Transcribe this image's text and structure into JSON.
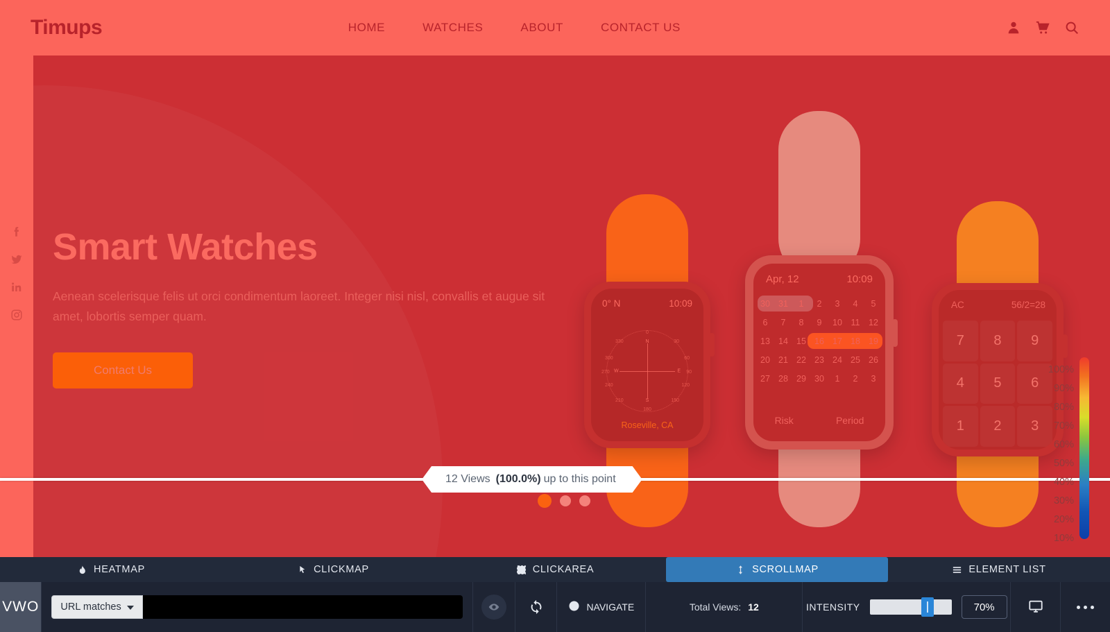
{
  "site": {
    "brand": "Timups",
    "nav": [
      {
        "label": "HOME"
      },
      {
        "label": "WATCHES"
      },
      {
        "label": "ABOUT"
      },
      {
        "label": "CONTACT US"
      }
    ],
    "header_icons": [
      {
        "name": "user-icon"
      },
      {
        "name": "cart-icon"
      },
      {
        "name": "search-icon"
      }
    ],
    "social": [
      {
        "name": "facebook-icon"
      },
      {
        "name": "twitter-icon"
      },
      {
        "name": "linkedin-icon"
      },
      {
        "name": "instagram-icon"
      }
    ],
    "hero": {
      "title": "Smart Watches",
      "subtitle": "Aenean scelerisque felis ut orci condimentum laoreet. Integer nisi nisl, convallis et augue sit amet, lobortis semper quam.",
      "cta": "Contact Us"
    },
    "watches": {
      "compass": {
        "bearing": "0° N",
        "time": "10:09",
        "location": "Roseville, CA",
        "cardinals": [
          "N",
          "S",
          "W",
          "E"
        ],
        "degrees": [
          "0",
          "30",
          "60",
          "90",
          "120",
          "150",
          "180",
          "210",
          "240",
          "270",
          "300",
          "330"
        ]
      },
      "calendar": {
        "date": "Apr, 12",
        "time": "10:09",
        "weeks": [
          [
            "30",
            "31",
            "1",
            "2",
            "3",
            "4",
            "5"
          ],
          [
            "6",
            "7",
            "8",
            "9",
            "10",
            "11",
            "12"
          ],
          [
            "13",
            "14",
            "15",
            "16",
            "17",
            "18",
            "19"
          ],
          [
            "20",
            "21",
            "22",
            "23",
            "24",
            "25",
            "26"
          ],
          [
            "27",
            "28",
            "29",
            "30",
            "1",
            "2",
            "3"
          ]
        ],
        "buttons": [
          "Risk",
          "Period"
        ]
      },
      "calculator": {
        "clear": "AC",
        "expression": "56/2=28",
        "keys": [
          "7",
          "8",
          "9",
          "4",
          "5",
          "6",
          "1",
          "2",
          "3"
        ]
      }
    }
  },
  "scrollmap": {
    "tooltip": {
      "views": "12 Views",
      "percent": "(100.0%)",
      "suffix": "up to this point"
    },
    "legend_labels": [
      "100%",
      "90%",
      "80%",
      "70%",
      "60%",
      "50%",
      "40%",
      "30%",
      "20%",
      "10%"
    ],
    "carousel_dots": 3,
    "active_dot": 0
  },
  "vwo": {
    "logo": "VWO",
    "tabs": [
      {
        "label": "HEATMAP",
        "icon": "flame-icon",
        "active": false
      },
      {
        "label": "CLICKMAP",
        "icon": "cursor-click-icon",
        "active": false
      },
      {
        "label": "CLICKAREA",
        "icon": "dashed-square-icon",
        "active": false
      },
      {
        "label": "SCROLLMAP",
        "icon": "updown-arrow-icon",
        "active": true
      },
      {
        "label": "ELEMENT LIST",
        "icon": "list-lines-icon",
        "active": false
      }
    ],
    "url_filter": {
      "mode": "URL matches",
      "value": "",
      "placeholder": ""
    },
    "toggle_visibility_icon": "eye-icon",
    "refresh_icon": "refresh-icon",
    "navigate": {
      "label": "NAVIGATE",
      "icon": "globe-icon"
    },
    "total_views": {
      "label": "Total Views:",
      "value": "12"
    },
    "intensity": {
      "label": "INTENSITY",
      "value": "70%",
      "percent": 70
    },
    "device_icon": "desktop-icon",
    "more_icon": "ellipsis-icon"
  },
  "colors": {
    "page_bg": "#fc655b",
    "hero_bg": "#cc2f34",
    "brand_red": "#b8232b",
    "cta_orange": "#fb5f08",
    "vwo_bar": "#1e2433",
    "vwo_active_tab": "#337ab7"
  }
}
